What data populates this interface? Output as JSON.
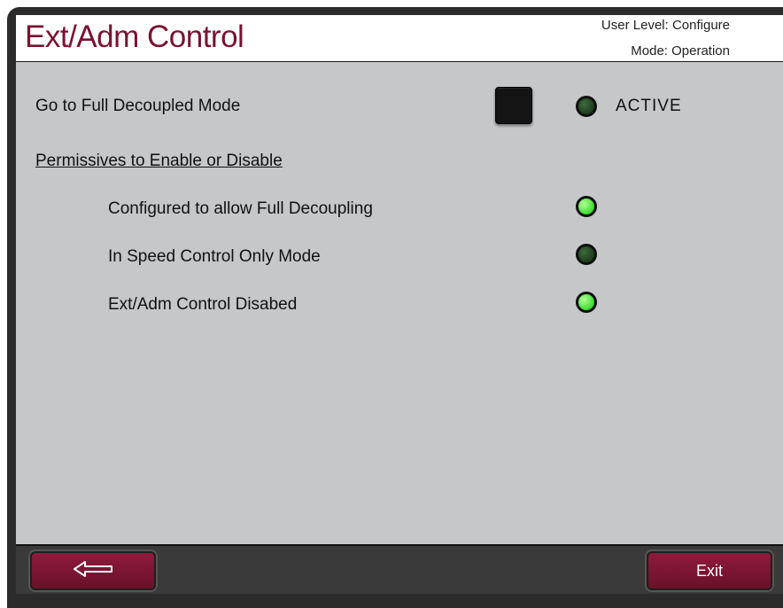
{
  "header": {
    "title": "Ext/Adm Control",
    "user_level": "User Level: Configure",
    "mode": "Mode: Operation"
  },
  "main": {
    "decoupled": {
      "label": "Go to Full Decoupled Mode",
      "status_label": "ACTIVE",
      "indicator_state": "off"
    },
    "permissives_heading": "Permissives to Enable or Disable",
    "permissives": [
      {
        "label": "Configured to allow Full Decoupling",
        "state": "on"
      },
      {
        "label": "In Speed Control Only Mode",
        "state": "off"
      },
      {
        "label": "Ext/Adm Control Disabed",
        "state": "on"
      }
    ]
  },
  "footer": {
    "back_icon": "left-arrow-icon",
    "exit_label": "Exit"
  },
  "colors": {
    "title": "#7a1230",
    "panel": "#c6c7c9",
    "button": "#7d1533",
    "led_on": "#49e33a",
    "led_off": "#2a4d2a"
  }
}
